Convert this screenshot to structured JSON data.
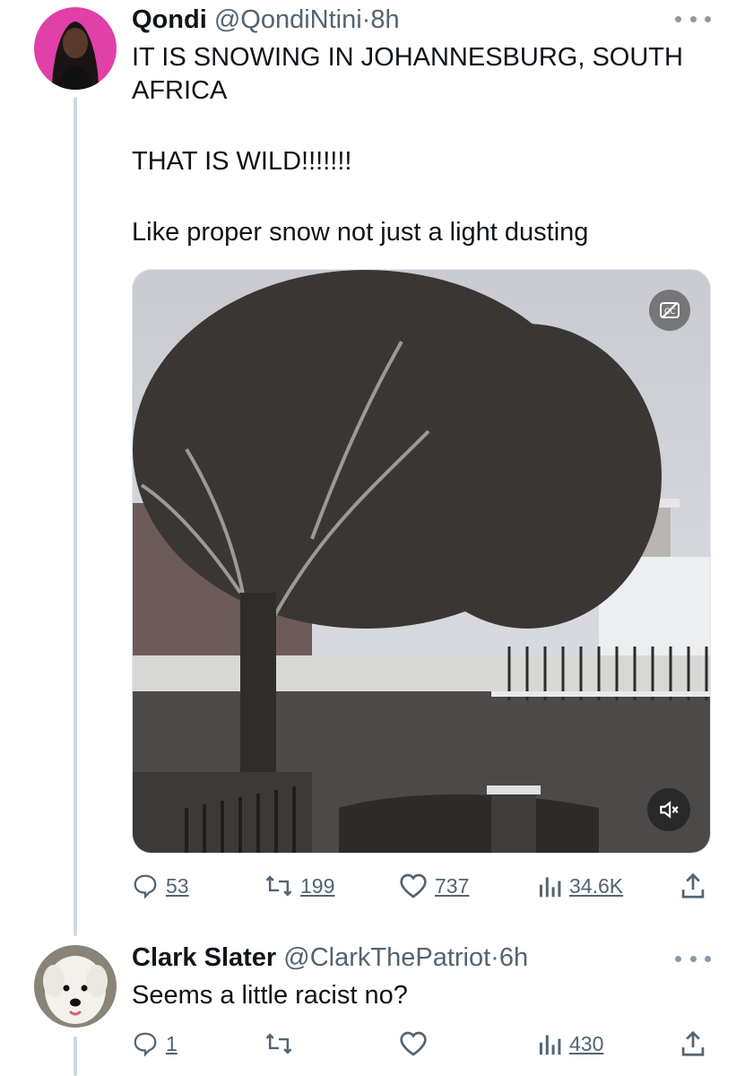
{
  "thread": [
    {
      "author_name": "Qondi",
      "author_handle": "@QondiNtini",
      "separator": "·",
      "time": "8h",
      "paragraphs": [
        "IT IS SNOWING IN JOHANNESBURG, SOUTH AFRICA",
        "THAT IS WILD!!!!!!!",
        "Like proper snow not just a light dusting"
      ],
      "media": {
        "type": "video",
        "description_icons": [
          "closed-captions-icon",
          "muted-speaker-icon"
        ]
      },
      "metrics": {
        "replies": "53",
        "reposts": "199",
        "likes": "737",
        "views": "34.6K"
      },
      "avatar_color": "#e040a8"
    },
    {
      "author_name": "Clark Slater",
      "author_handle": "@ClarkThePatriot",
      "separator": "·",
      "time": "6h",
      "paragraphs": [
        "Seems a little racist no?"
      ],
      "metrics": {
        "replies": "1",
        "reposts": "",
        "likes": "",
        "views": "430"
      }
    }
  ],
  "colors": {
    "text": "#0f1419",
    "secondary": "#536471",
    "thread_line": "#cfd9de"
  }
}
